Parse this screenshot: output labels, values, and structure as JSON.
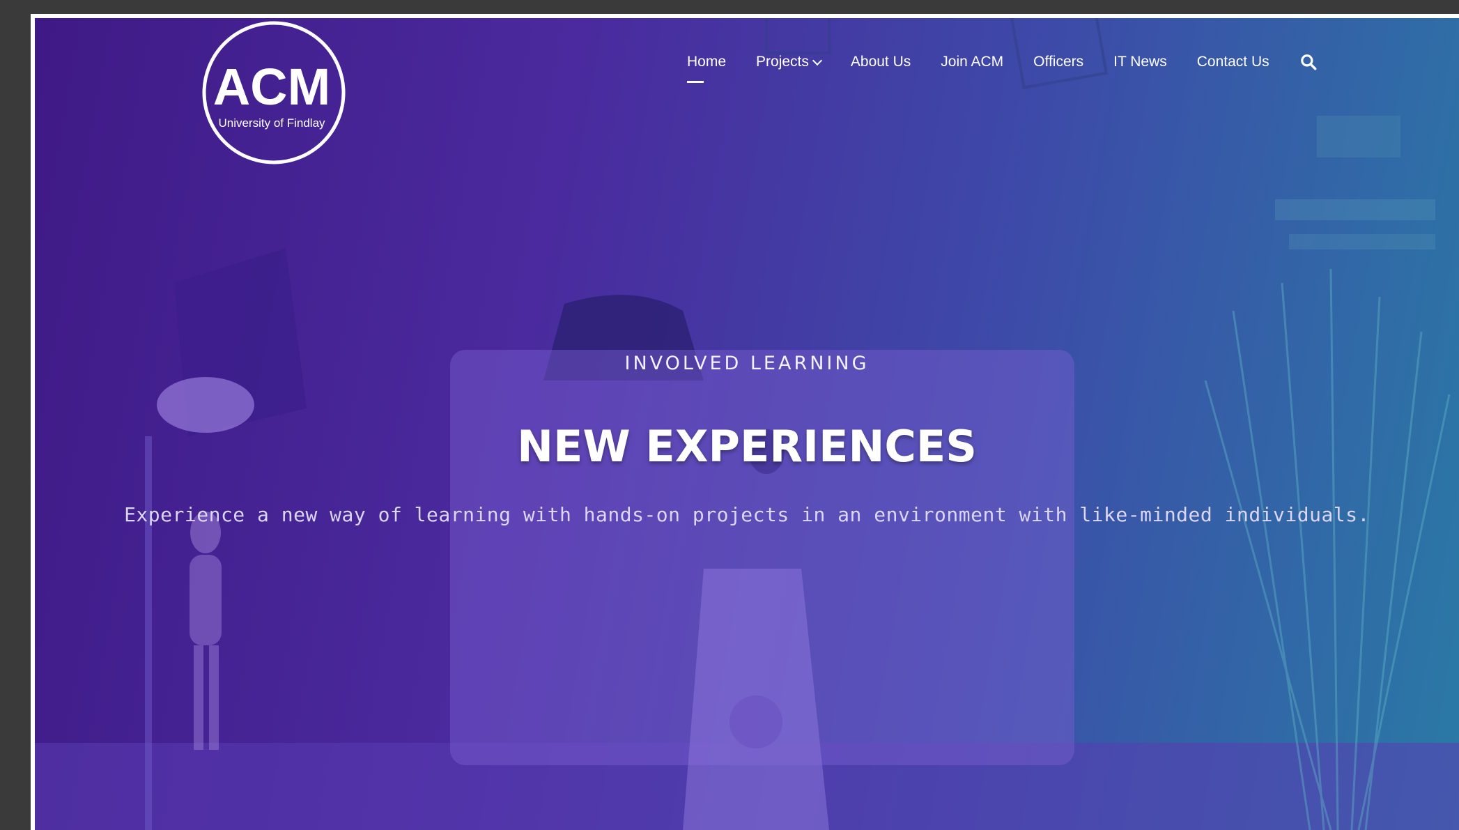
{
  "site": {
    "logo_text": "ACM",
    "logo_subtext": "University of Findlay"
  },
  "nav": {
    "items": [
      {
        "label": "Home",
        "active": true
      },
      {
        "label": "Projects",
        "has_dropdown": true
      },
      {
        "label": "About Us"
      },
      {
        "label": "Join ACM"
      },
      {
        "label": "Officers"
      },
      {
        "label": "IT News"
      },
      {
        "label": "Contact Us"
      }
    ],
    "search_icon": "search-icon"
  },
  "hero": {
    "kicker": "INVOLVED LEARNING",
    "headline": "NEW EXPERIENCES",
    "subtext": "Experience a new way of learning with hands-on projects in an environment with like-minded individuals."
  },
  "colors": {
    "gradient_start": "#3f1a86",
    "gradient_end": "#2a7aa6",
    "text": "#ffffff"
  }
}
